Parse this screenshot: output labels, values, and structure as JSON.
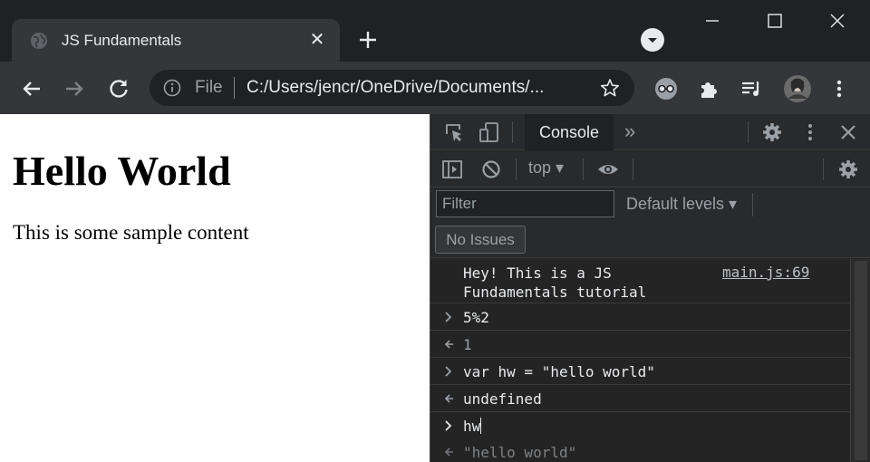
{
  "tab": {
    "title": "JS Fundamentals",
    "favicon": "globe-icon"
  },
  "omnibox": {
    "scheme": "File",
    "url": "C:/Users/jencr/OneDrive/Documents/..."
  },
  "page": {
    "heading": "Hello World",
    "paragraph": "This is some sample content"
  },
  "devtools": {
    "tabs": [
      "Console"
    ],
    "more_tabs_label": "»",
    "context": "top ▾",
    "filter_placeholder": "Filter",
    "levels": "Default levels ▾",
    "issues": "No Issues",
    "console": {
      "log": {
        "line1": "Hey! This is a JS",
        "line2": "Fundamentals tutorial",
        "source": "main.js:69"
      },
      "entries": [
        {
          "kind": "input",
          "text": "5%2"
        },
        {
          "kind": "output",
          "text": "1"
        },
        {
          "kind": "input",
          "text": "var hw = \"hello world\""
        },
        {
          "kind": "output",
          "text": "undefined"
        },
        {
          "kind": "input",
          "text": "hw"
        },
        {
          "kind": "output",
          "text": "\"hello world\""
        }
      ]
    }
  },
  "colors": {
    "page_bg": "#ffffff",
    "devtools_bg": "#242424",
    "chrome_toolbar": "#35363a",
    "titlebar": "#202124"
  }
}
